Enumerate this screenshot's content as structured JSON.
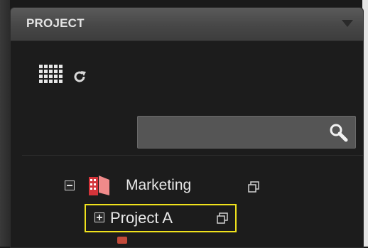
{
  "panel": {
    "title": "PROJECT",
    "collapse_icon": "triangle-down-icon"
  },
  "toolbar": {
    "grid_icon": "grid-view-icon",
    "refresh_icon": "refresh-icon"
  },
  "search": {
    "value": "",
    "placeholder": "",
    "icon": "magnifier-icon"
  },
  "tree": {
    "items": [
      {
        "label": "Marketing",
        "expanded": true,
        "icon": "folder-icon",
        "action_icon": "copy-icon"
      },
      {
        "label": "Project A",
        "expanded": false,
        "selected": true,
        "action_icon": "copy-icon"
      }
    ]
  },
  "colors": {
    "highlight": "#f0e21c",
    "folder_red": "#d4343a",
    "folder_pink": "#f08a8a"
  }
}
